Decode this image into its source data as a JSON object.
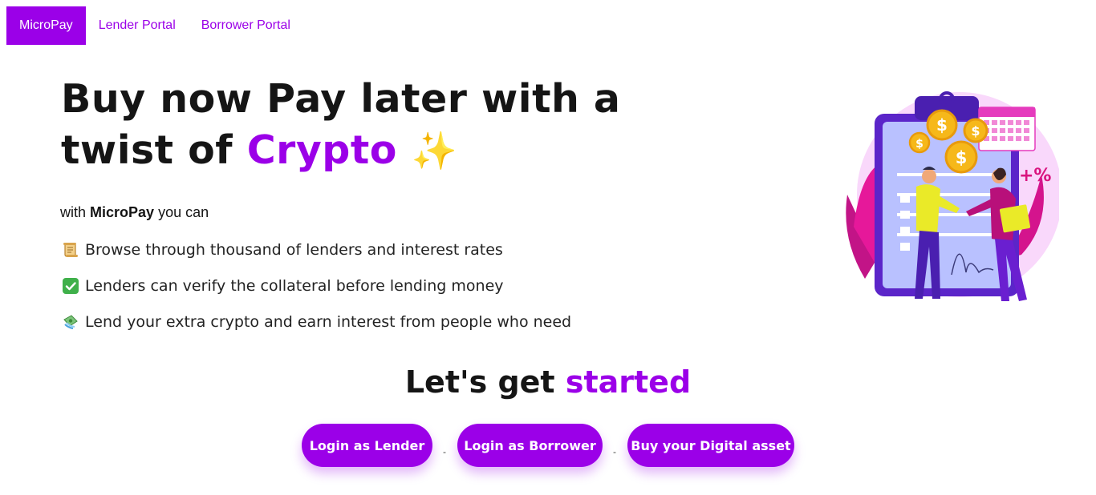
{
  "nav": {
    "brand": "MicroPay",
    "links": [
      "Lender Portal",
      "Borrower Portal"
    ]
  },
  "hero": {
    "title_part1": "Buy now Pay later with a twist of ",
    "title_accent": "Crypto",
    "title_emoji": "✨"
  },
  "lead": {
    "prefix": "with ",
    "brand": "MicroPay",
    "suffix": " you can"
  },
  "features": [
    {
      "icon": "📜",
      "text": "Browse through thousand of lenders and interest rates"
    },
    {
      "icon": "✅",
      "text": "Lenders can verify the collateral before lending money"
    },
    {
      "icon": "💸",
      "text": "Lend your extra crypto and earn interest from people who need"
    }
  ],
  "cta": {
    "title": "Let's get ",
    "title_accent": "started",
    "buttons": [
      "Login as Lender",
      "Login as Borrower",
      "Buy your Digital asset"
    ],
    "separator": "-"
  },
  "colors": {
    "accent": "#9b00e8",
    "text": "#151515"
  }
}
